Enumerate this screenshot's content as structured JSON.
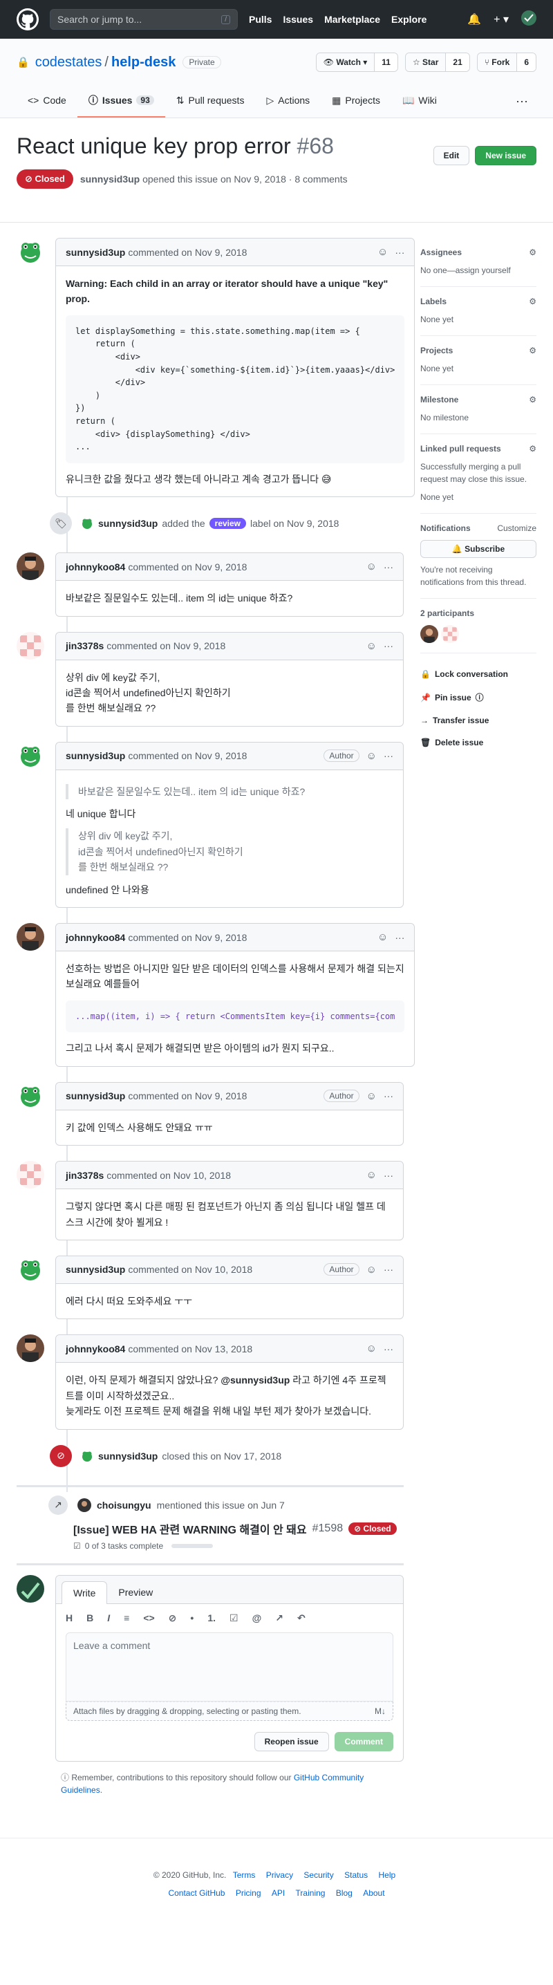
{
  "topbar": {
    "search_placeholder": "Search or jump to...",
    "search_key": "/",
    "nav": [
      "Pulls",
      "Issues",
      "Marketplace",
      "Explore"
    ]
  },
  "repo": {
    "owner": "codestates",
    "name": "help-desk",
    "visibility": "Private",
    "watch_label": "Watch",
    "watch_count": "11",
    "star_label": "Star",
    "star_count": "21",
    "fork_label": "Fork",
    "fork_count": "6"
  },
  "tabs": [
    {
      "label": "Code"
    },
    {
      "label": "Issues",
      "count": "93"
    },
    {
      "label": "Pull requests"
    },
    {
      "label": "Actions"
    },
    {
      "label": "Projects"
    },
    {
      "label": "Wiki"
    }
  ],
  "issue": {
    "title": "React unique key prop error",
    "number": "#68",
    "state": "Closed",
    "author": "sunnysid3up",
    "opened_text": "opened this issue on Nov 9, 2018 · 8 comments",
    "edit_label": "Edit",
    "new_issue_label": "New issue"
  },
  "comments": [
    {
      "author": "sunnysid3up",
      "date": "commented on Nov 9, 2018",
      "warning": "Warning: Each child in an array or iterator should have a unique \"key\" prop.",
      "code": "let displaySomething = this.state.something.map(item => {\n    return (\n        <div>\n            <div key={`something-${item.id}`}>{item.yaaas}</div>\n        </div>\n    )\n})\nreturn (\n    <div> {displaySomething} </div>\n...",
      "text": "유니크한 값을 줬다고 생각 했는데 아니라고 계속 경고가 뜹니다 😅"
    },
    {
      "author": "johnnykoo84",
      "date": "commented on Nov 9, 2018",
      "text": "바보같은 질문일수도 있는데.. item 의 id는 unique 하죠?"
    },
    {
      "author": "jin3378s",
      "date": "commented on Nov 9, 2018",
      "text": "상위 div 에 key값 주기,\nid콘솔 찍어서 undefined아닌지 확인하기\n를 한번 해보실래요 ??"
    },
    {
      "author": "sunnysid3up",
      "date": "commented on Nov 9, 2018",
      "badge": "Author",
      "quote1": "바보같은 질문일수도 있는데.. item 의 id는 unique 하죠?",
      "reply1": "네 unique 합니다",
      "quote2": "상위 div 에 key값 주기,\nid콘솔 찍어서 undefined아닌지 확인하기\n를 한번 해보실래요 ??",
      "reply2": "undefined 안 나와용"
    },
    {
      "author": "johnnykoo84",
      "date": "commented on Nov 9, 2018",
      "text1": "선호하는 방법은 아니지만 일단 받은 데이터의 인덱스를 사용해서 문제가 해결 되는지 보실래요 예를들어",
      "code": "...map((item, i) => { return <CommentsItem key={i} comments={com",
      "text2": "그리고 나서 혹시 문제가 해결되면 받은 아이템의 id가 뭔지 되구요.."
    },
    {
      "author": "sunnysid3up",
      "date": "commented on Nov 9, 2018",
      "badge": "Author",
      "text": "키 값에 인덱스 사용해도 안돼요 ㅠㅠ"
    },
    {
      "author": "jin3378s",
      "date": "commented on Nov 10, 2018",
      "text": "그렇지 않다면 혹시 다른 매핑 된 컴포넌트가 아닌지 좀 의심 됩니다 내일 헬프 데스크 시간에 찾아 뵐게요 !"
    },
    {
      "author": "sunnysid3up",
      "date": "commented on Nov 10, 2018",
      "badge": "Author",
      "text": "에러 다시 떠요 도와주세요 ㅜㅜ"
    },
    {
      "author": "johnnykoo84",
      "date": "commented on Nov 13, 2018",
      "text_before": "이런, 아직 문제가 해결되지 않았나요? ",
      "mention": "@sunnysid3up",
      "text_after": " 라고 하기엔 4주 프로젝트를 이미 시작하셨겠군요..\n늦게라도 이전 프로젝트 문제 해결을 위해 내일 부턴 제가 찾아가 보겠습니다."
    }
  ],
  "events": {
    "labeled": {
      "actor": "sunnysid3up",
      "pre": "added the",
      "label": "review",
      "post": "label on Nov 9, 2018"
    },
    "closed": {
      "actor": "sunnysid3up",
      "text": "closed this on Nov 17, 2018"
    },
    "mention": {
      "actor": "choisungyu",
      "text": "mentioned this issue on Jun 7",
      "title": "[Issue] WEB HA 관련 WARNING 해결이 안 돼요",
      "number": "#1598",
      "state": "Closed",
      "tasks": "0 of 3 tasks complete"
    }
  },
  "sidebar": {
    "assignees_title": "Assignees",
    "assignees_value": "No one—assign yourself",
    "labels_title": "Labels",
    "labels_value": "None yet",
    "projects_title": "Projects",
    "projects_value": "None yet",
    "milestone_title": "Milestone",
    "milestone_value": "No milestone",
    "linked_title": "Linked pull requests",
    "linked_desc": "Successfully merging a pull request may close this issue.",
    "linked_value": "None yet",
    "notif_title": "Notifications",
    "notif_customize": "Customize",
    "subscribe_label": "Subscribe",
    "notif_desc": "You're not receiving notifications from this thread.",
    "participants_title": "2 participants",
    "actions": [
      "Lock conversation",
      "Pin issue",
      "Transfer issue",
      "Delete issue"
    ]
  },
  "composer": {
    "tab_write": "Write",
    "tab_preview": "Preview",
    "tools": [
      "H",
      "B",
      "I",
      "≡",
      "<>",
      "⊘",
      "•",
      "1.",
      "☑",
      "@",
      "↗",
      "↶"
    ],
    "placeholder": "Leave a comment",
    "attach_text": "Attach files by dragging & dropping, selecting or pasting them.",
    "reopen_label": "Reopen issue",
    "comment_label": "Comment",
    "note_text": "Remember, contributions to this repository should follow our ",
    "note_link": "GitHub Community Guidelines",
    "note_end": "."
  },
  "footer": {
    "copyright": "© 2020 GitHub, Inc.",
    "row1": [
      "Terms",
      "Privacy",
      "Security",
      "Status",
      "Help"
    ],
    "row2": [
      "Contact GitHub",
      "Pricing",
      "API",
      "Training",
      "Blog",
      "About"
    ]
  },
  "colors": {
    "closed": "#cb2431",
    "label_review": "#7057ff",
    "new_issue": "#2ea44f",
    "link": "#0366d6"
  }
}
